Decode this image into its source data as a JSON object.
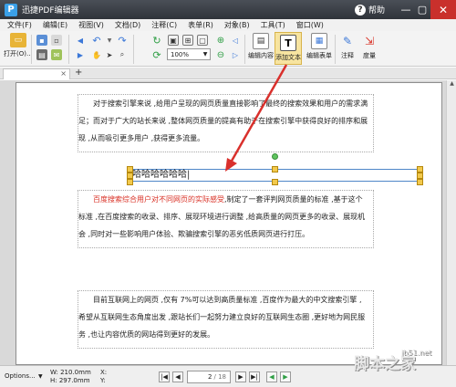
{
  "titlebar": {
    "logo": "P",
    "title": "迅捷PDF编辑器",
    "help_label": "帮助",
    "minimize": "—",
    "maximize": "▢",
    "close": "✕"
  },
  "menu": [
    "文件(F)",
    "编辑(E)",
    "视图(V)",
    "文档(D)",
    "注释(C)",
    "表单(R)",
    "对象(B)",
    "工具(T)",
    "窗口(W)"
  ],
  "toolbar": {
    "open_label": "打开(O)...",
    "zoom_value": "100%",
    "edit_content": "编辑内容",
    "add_text": "添加文本",
    "edit_form": "编辑表单",
    "annotate": "注释",
    "measure": "度量"
  },
  "tab": {
    "close": "×",
    "add": "+"
  },
  "document": {
    "para1": [
      "对于搜索引擎来说 ,给用户呈现的网页质量直接影响了最终的搜索效果和用户的需求满",
      "足；而对于广大的站长来说 ,整体网页质量的提高有助于在搜索引擎中获得良好的排序和展",
      "现 ,从而吸引更多用户 ,获得更多流量。"
    ],
    "inserted_text": "哈哈哈哈哈哈|",
    "para2_red": "百度搜索综合用户对不同网页的实际感受",
    "para2": [
      ",制定了一套评判网页质量的标准 ,基于这个",
      "标准 ,在百度搜索的收录、排序、展现环境进行调整 ,给高质量的网页更多的收录、展现机",
      "会 ,同时对一些影响用户体验、欺骗搜索引擎的恶劣低质网页进行打压。"
    ],
    "para3": [
      "目前互联网上的网页 ,仅有 7%可以达到高质量标准 ,百度作为最大的中文搜索引擎 ,",
      "希望从互联网生态角度出发 ,跟站长们一起努力建立良好的互联网生态圈 ,更好地为网民服",
      "务 ,也让内容优质的网站得到更好的发展。"
    ]
  },
  "status": {
    "options": "Options...",
    "width": "W: 210.0mm",
    "height": "H: 297.0mm",
    "x": "X:",
    "y": "Y:",
    "page_current": "2",
    "page_total": "/ 18"
  },
  "watermark": {
    "main": "脚本之家",
    "small": "jb51.net"
  },
  "colors": {
    "titlebar": "#3a3e45",
    "accent_red": "#d93025",
    "arrow": "#d9302c",
    "selection": "#4f87c8"
  }
}
